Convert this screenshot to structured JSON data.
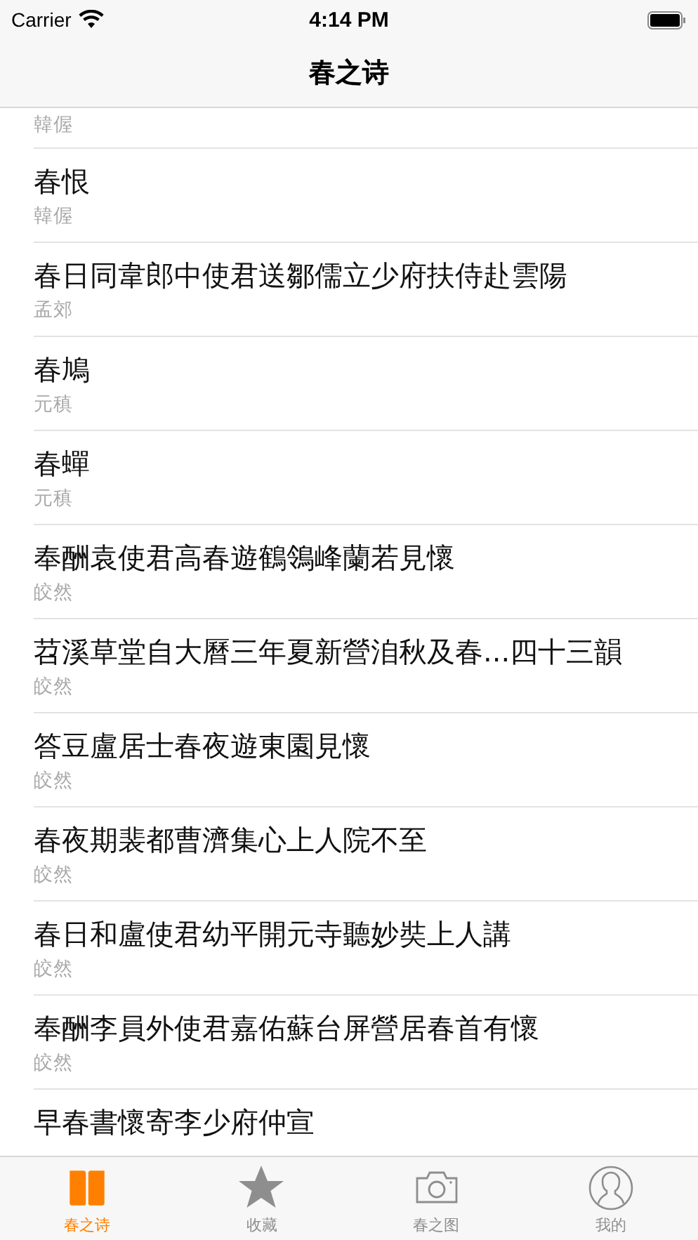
{
  "status_bar": {
    "carrier": "Carrier",
    "time": "4:14 PM"
  },
  "nav_bar": {
    "title": "春之诗"
  },
  "poems": [
    {
      "author": "韓偓"
    },
    {
      "title": "春恨",
      "author": "韓偓"
    },
    {
      "title": "春日同韋郎中使君送鄒儒立少府扶侍赴雲陽",
      "author": "孟郊"
    },
    {
      "title": "春鳩",
      "author": "元稹"
    },
    {
      "title": "春蟬",
      "author": "元稹"
    },
    {
      "title": "奉酬袁使君高春遊鶴鴒峰蘭若見懷",
      "author": "皎然"
    },
    {
      "title": "苕溪草堂自大曆三年夏新營洎秋及春...四十三韻",
      "author": "皎然"
    },
    {
      "title": "答豆盧居士春夜遊東園見懷",
      "author": "皎然"
    },
    {
      "title": "春夜期裴都曹濟集心上人院不至",
      "author": "皎然"
    },
    {
      "title": "春日和盧使君幼平開元寺聽妙奘上人講",
      "author": "皎然"
    },
    {
      "title": "奉酬李員外使君嘉佑蘇台屏營居春首有懷",
      "author": "皎然"
    },
    {
      "title": "早春書懷寄李少府仲宣"
    }
  ],
  "tab_bar": [
    {
      "kind": "book",
      "label": "春之诗",
      "selected": true
    },
    {
      "kind": "star",
      "label": "收藏",
      "selected": false
    },
    {
      "kind": "camera",
      "label": "春之图",
      "selected": false
    },
    {
      "kind": "person",
      "label": "我的",
      "selected": false
    }
  ]
}
